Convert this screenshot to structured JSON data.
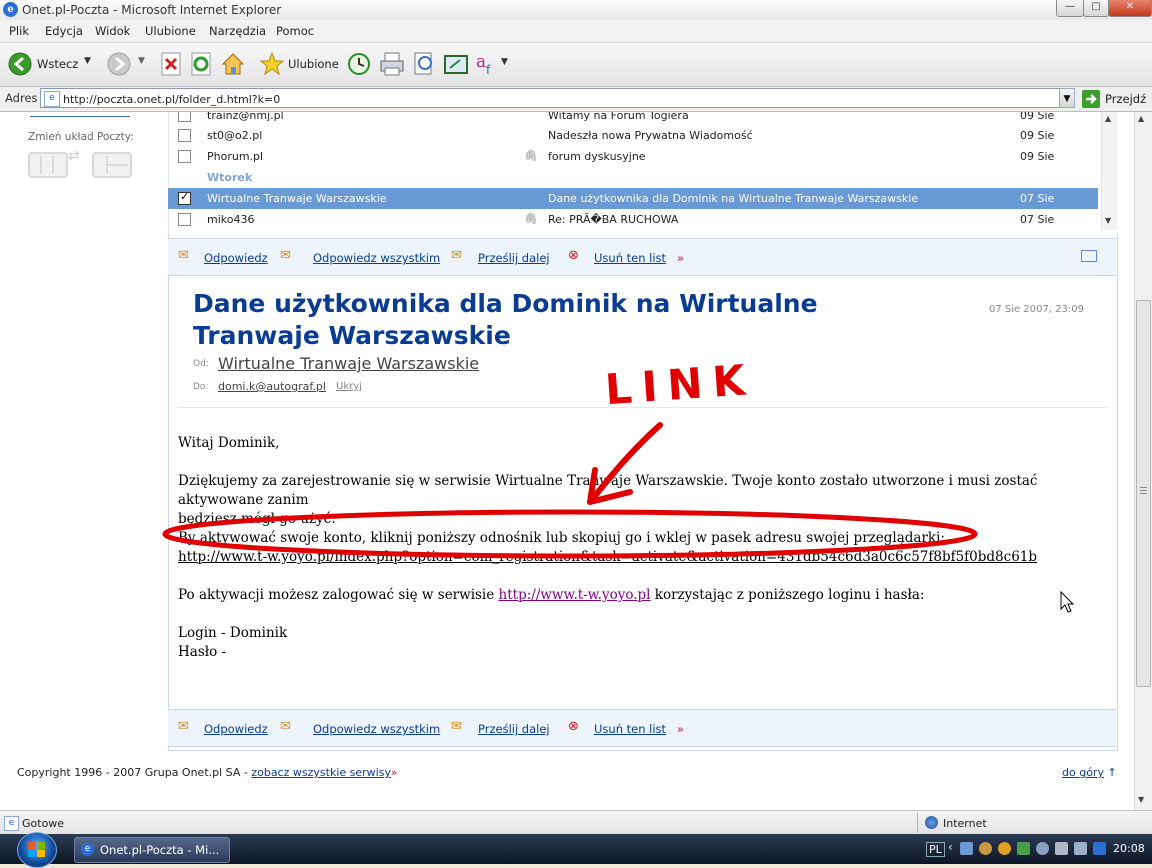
{
  "window": {
    "title": "Onet.pl-Poczta - Microsoft Internet Explorer",
    "min_label": "—",
    "max_label": "□",
    "close_label": "✕"
  },
  "menu": [
    "Plik",
    "Edycja",
    "Widok",
    "Ulubione",
    "Narzędzia",
    "Pomoc"
  ],
  "toolbar": {
    "back_label": "Wstecz",
    "favorites_label": "Ulubione"
  },
  "address": {
    "label": "Adres",
    "url": "http://poczta.onet.pl/folder_d.html?k=0",
    "go_label": "Przejdź"
  },
  "sidebar": {
    "layout_label": "Zmień układ Poczty:"
  },
  "mail_list": {
    "group_label": "Wtorek",
    "rows": [
      {
        "from": "trainz@nmj.pl",
        "subject": "Witamy na Forum Togiera",
        "date": "09 Sie",
        "attach": false,
        "checked": false,
        "selected": false
      },
      {
        "from": "st0@o2.pl",
        "subject": "Nadeszła nowa Prywatna Wiadomość",
        "date": "09 Sie",
        "attach": false,
        "checked": false,
        "selected": false
      },
      {
        "from": "Phorum.pl",
        "subject": "forum dyskusyjne",
        "date": "09 Sie",
        "attach": true,
        "checked": false,
        "selected": false
      },
      {
        "from": "Wirtualne Tranwaje Warszawskie",
        "subject": "Dane użytkownika dla Dominik na Wirtualne Tranwaje Warszawskie",
        "date": "07 Sie",
        "attach": false,
        "checked": true,
        "selected": true
      },
      {
        "from": "miko436",
        "subject": "Re: PRÃ�BA RUCHOWA",
        "date": "07 Sie",
        "attach": true,
        "checked": false,
        "selected": false
      }
    ]
  },
  "actions": {
    "reply": "Odpowiedz",
    "reply_all": "Odpowiedz wszystkim",
    "forward": "Prześlij dalej",
    "delete": "Usuń ten list",
    "more": "»"
  },
  "message": {
    "subject_line1": "Dane użytkownika dla Dominik na Wirtualne",
    "subject_line2": "Tranwaje Warszawskie",
    "date": "07 Sie 2007, 23:09",
    "from_label": "Od:",
    "from_name": "Wirtualne Tranwaje Warszawskie",
    "to_label": "Do:",
    "to_email": "domi.k@autograf.pl",
    "hide_label": "Ukryj",
    "body": {
      "greeting": "Witaj Dominik,",
      "p1_line1": "Dziękujemy za zarejestrowanie się w serwisie Wirtualne Tranwaje Warszawskie. Twoje konto zostało utworzone i musi zostać aktywowane zanim",
      "p1_line2": "będziesz mógł go użyć.",
      "p1_line3": "By aktywować swoje konto, kliknij poniższy odnośnik lub skopiuj go i wklej w pasek adresu swojej przeglądarki:",
      "activation_link": "http://www.t-w.yoyo.pl/index.php?option=com_registration&task=activate&activation=431db54c6d3a0c6c57f8bf5f0bd8c61b",
      "p2_before": "Po aktywacji możesz zalogować się w serwisie ",
      "p2_link": "http://www.t-w.yoyo.pl",
      "p2_after": " korzystając z poniższego loginu i hasła:",
      "login": "Login - Dominik",
      "password": "Hasło -"
    }
  },
  "annotation": {
    "text": "LINK",
    "color": "#e00000"
  },
  "footer": {
    "copyright": "Copyright 1996 - 2007 Grupa Onet.pl SA - ",
    "all_services": "zobacz wszystkie serwisy",
    "back_to_top": "do góry"
  },
  "statusbar": {
    "status": "Gotowe",
    "zone": "Internet"
  },
  "taskbar": {
    "task_label": "Onet.pl-Poczta - Mi...",
    "lang": "PL",
    "clock": "20:08"
  },
  "colors": {
    "link": "#0a3d91",
    "subject": "#0a3d91",
    "selected_row": "#6a9ad6",
    "group": "#7fa6d8"
  }
}
